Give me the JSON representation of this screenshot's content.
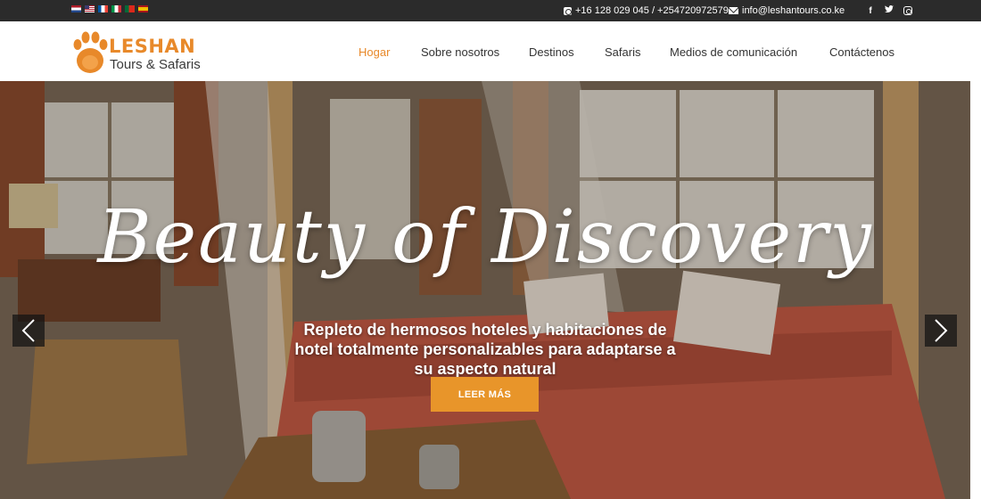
{
  "topbar": {
    "languages": [
      "Nederlands",
      "English",
      "Français",
      "Italiano",
      "Português",
      "Español"
    ],
    "phone": "+16 128 029 045 / +254720972579",
    "email": "info@leshantours.co.ke",
    "social": [
      "facebook-icon",
      "twitter-icon",
      "instagram-icon"
    ]
  },
  "logo": {
    "title": "LESHAN",
    "subtitle": "Tours & Safaris"
  },
  "nav": {
    "items": [
      {
        "label": "Hogar",
        "active": true
      },
      {
        "label": "Sobre nosotros",
        "active": false
      },
      {
        "label": "Destinos",
        "active": false
      },
      {
        "label": "Safaris",
        "active": false
      },
      {
        "label": "Medios de comunicación",
        "active": false
      },
      {
        "label": "Contáctenos",
        "active": false
      }
    ]
  },
  "hero": {
    "headline": "Beauty of Discovery",
    "subline": "Repleto de hermosos hoteles y habitaciones de hotel totalmente personalizables para adaptarse a su aspecto natural",
    "cta": "LEER MÁS"
  },
  "colors": {
    "accent": "#e8892a",
    "topbar": "#2b2b2b",
    "cta": "#e8952a"
  }
}
